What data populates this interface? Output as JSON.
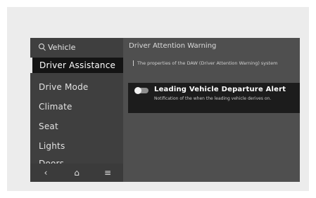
{
  "sidebar": {
    "search_label": "Vehicle",
    "items": [
      {
        "label": "Driver Assistance",
        "active": true
      },
      {
        "label": "Drive Mode",
        "active": false
      },
      {
        "label": "Climate",
        "active": false
      },
      {
        "label": "Seat",
        "active": false
      },
      {
        "label": "Lights",
        "active": false
      },
      {
        "label": "Doors",
        "active": false
      }
    ]
  },
  "bottom_bar": {
    "back_icon": "‹",
    "home_icon": "⌂",
    "menu_icon": "≡"
  },
  "main": {
    "title": "Driver Attention Warning",
    "description": "The properties of the DAW (Driver Attention Warning) system",
    "setting": {
      "title": "Leading Vehicle Departure Alert",
      "subtitle": "Notification of the when the leading vehicle derives on.",
      "enabled": false
    }
  },
  "colors": {
    "page_background": "#ececec",
    "screen_background": "#4f4f4f",
    "sidebar_background": "#3f3f3f",
    "active_item_background": "#141414",
    "card_background": "#1c1c1c"
  }
}
